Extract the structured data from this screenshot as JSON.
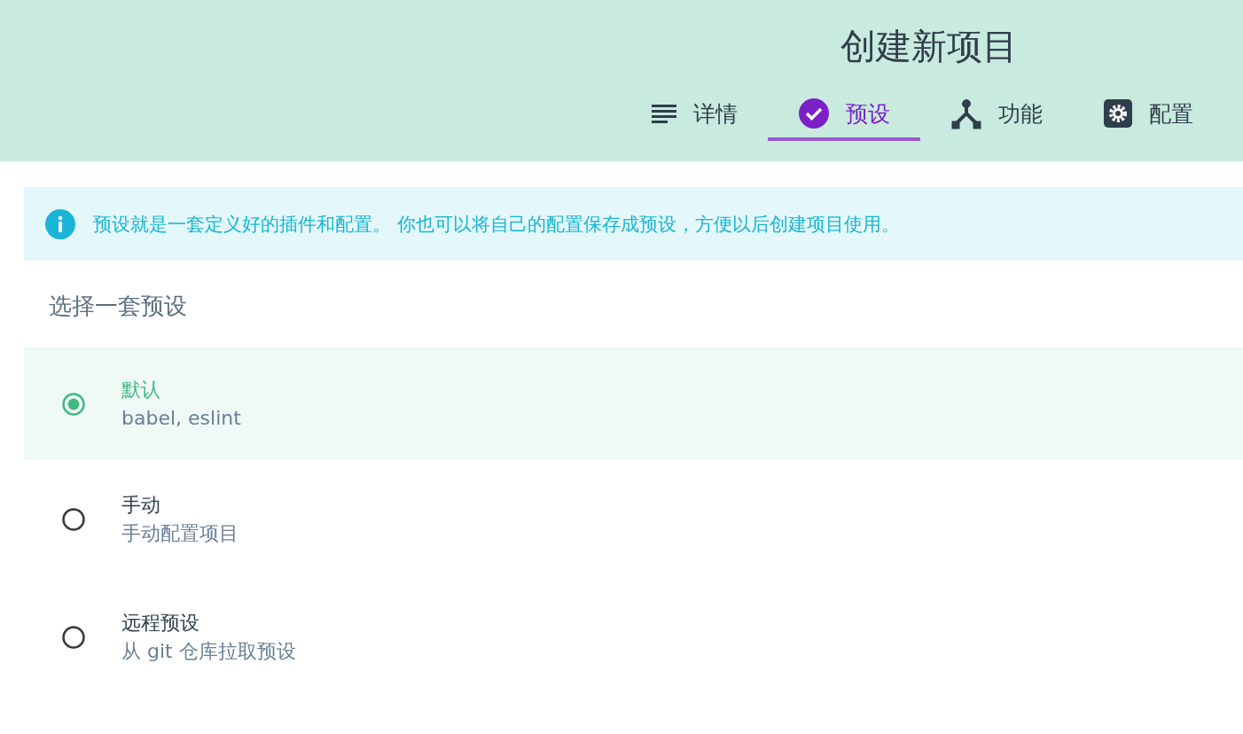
{
  "header": {
    "title": "创建新项目"
  },
  "tabs": [
    {
      "label": "详情",
      "selected": false
    },
    {
      "label": "预设",
      "selected": true
    },
    {
      "label": "功能",
      "selected": false
    },
    {
      "label": "配置",
      "selected": false
    }
  ],
  "info": {
    "text": "预设就是一套定义好的插件和配置。 你也可以将自己的配置保存成预设，方便以后创建项目使用。"
  },
  "section_title": "选择一套预设",
  "presets": [
    {
      "name": "默认",
      "description": "babel, eslint",
      "selected": true
    },
    {
      "name": "手动",
      "description": "手动配置项目",
      "selected": false
    },
    {
      "name": "远程预设",
      "description": "从 git 仓库拉取预设",
      "selected": false
    }
  ]
}
